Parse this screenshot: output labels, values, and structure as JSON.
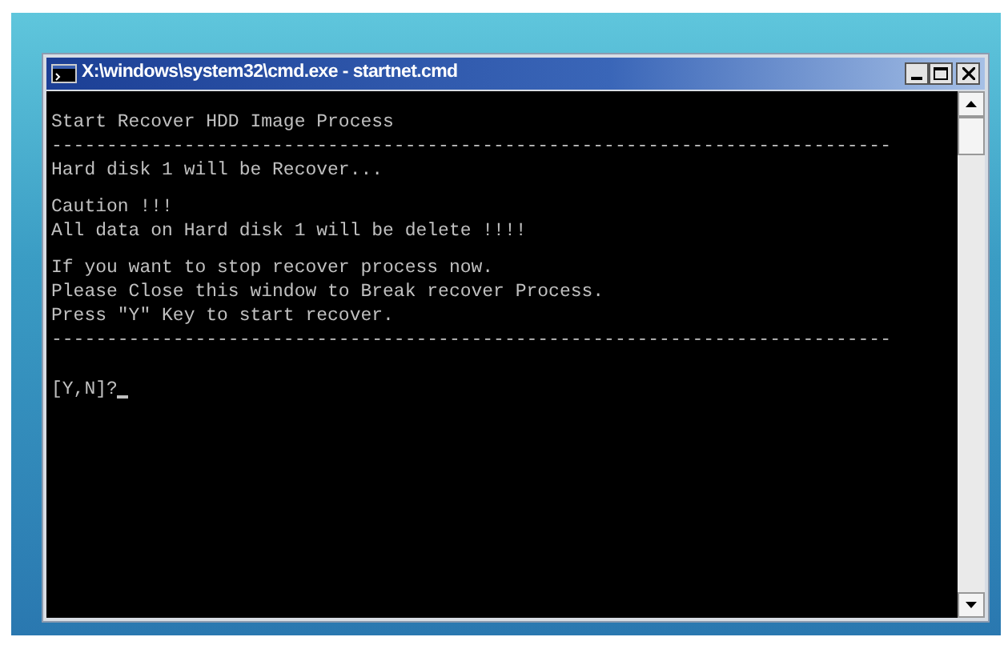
{
  "window": {
    "title": "X:\\windows\\system32\\cmd.exe - startnet.cmd"
  },
  "console": {
    "lines": [
      {
        "kind": "text",
        "text": "Start Recover HDD Image Process"
      },
      {
        "kind": "text",
        "text": "----------------------------------------------------------------------------"
      },
      {
        "kind": "text",
        "text": "Hard disk 1 will be Recover..."
      },
      {
        "kind": "gap"
      },
      {
        "kind": "text",
        "text": "Caution !!!"
      },
      {
        "kind": "text",
        "text": "All data on Hard disk 1 will be delete !!!!"
      },
      {
        "kind": "gap"
      },
      {
        "kind": "text",
        "text": "If you want to stop recover process now."
      },
      {
        "kind": "text",
        "text": "Please Close this window to Break recover Process."
      },
      {
        "kind": "text",
        "text": "Press \"Y\" Key to start recover."
      },
      {
        "kind": "text",
        "text": "----------------------------------------------------------------------------"
      },
      {
        "kind": "gap"
      },
      {
        "kind": "gap"
      },
      {
        "kind": "prompt",
        "text": "[Y,N]?"
      }
    ]
  }
}
